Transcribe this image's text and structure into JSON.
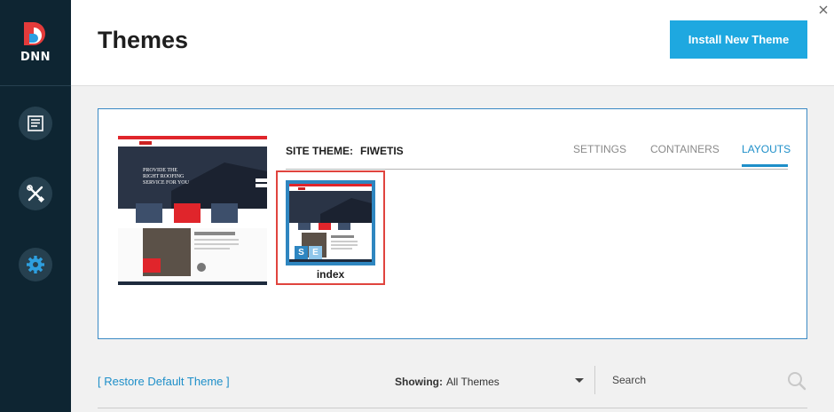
{
  "app": {
    "logo_text": "DNN"
  },
  "sidebar": {
    "items": [
      {
        "icon": "content-icon"
      },
      {
        "icon": "tools-icon"
      },
      {
        "icon": "gear-icon"
      }
    ]
  },
  "header": {
    "title": "Themes",
    "install_label": "Install New Theme"
  },
  "panel": {
    "site_theme_label": "SITE THEME:",
    "site_theme_name": "FIWETIS",
    "tabs": [
      {
        "label": "SETTINGS",
        "active": false
      },
      {
        "label": "CONTAINERS",
        "active": false
      },
      {
        "label": "LAYOUTS",
        "active": true
      }
    ],
    "layouts": [
      {
        "name": "index",
        "badges": [
          "S",
          "E"
        ]
      }
    ],
    "preview_text": {
      "hero": "PROVIDE THE RIGHT ROOFING SERVICE FOR YOU",
      "section": "Specializing in Roofing Services for 20 Years"
    }
  },
  "bottom_bar": {
    "restore_label": "[ Restore Default Theme ]",
    "showing_label": "Showing:",
    "showing_value": "All Themes",
    "search_placeholder": "Search"
  },
  "colors": {
    "sidebar_bg": "#0e2532",
    "accent": "#1ea8e0",
    "active_tab": "#1e8fc9",
    "selection_red": "#e0443e"
  }
}
